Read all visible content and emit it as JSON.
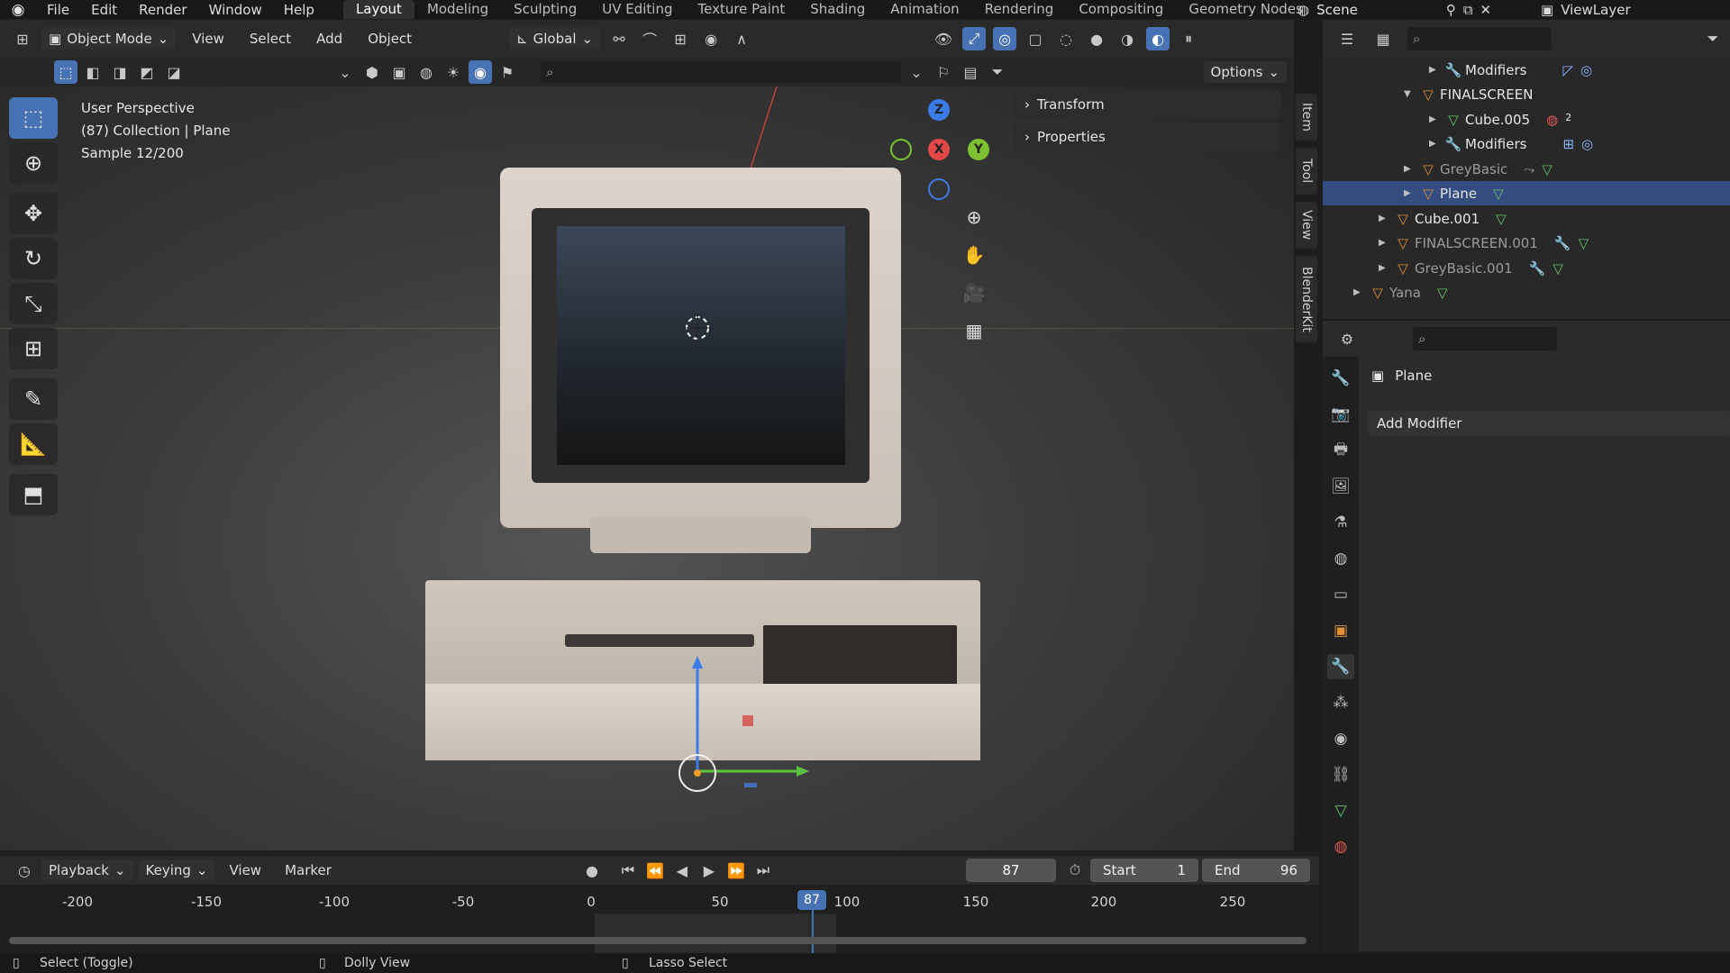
{
  "menu": {
    "items": [
      "File",
      "Edit",
      "Render",
      "Window",
      "Help"
    ]
  },
  "workspaces": [
    "Layout",
    "Modeling",
    "Sculpting",
    "UV Editing",
    "Texture Paint",
    "Shading",
    "Animation",
    "Rendering",
    "Compositing",
    "Geometry Nodes"
  ],
  "active_workspace": "Layout",
  "scene_name": "Scene",
  "view_layer": "ViewLayer",
  "viewport_header": {
    "mode": "Object Mode",
    "menus": [
      "View",
      "Select",
      "Add",
      "Object"
    ],
    "transform_orientation": "Global",
    "options_label": "Options"
  },
  "viewport_overlay": {
    "line1": "User Perspective",
    "line2": "(87) Collection | Plane",
    "line3": "Sample 12/200"
  },
  "gizmo": {
    "z": "Z",
    "x": "X",
    "y": "Y"
  },
  "npanel": {
    "transform": "Transform",
    "properties": "Properties",
    "tabs": [
      "Item",
      "Tool",
      "View",
      "BlenderKit"
    ]
  },
  "timeline": {
    "menus": [
      "Playback",
      "Keying",
      "View",
      "Marker"
    ],
    "current_frame": "87",
    "start_label": "Start",
    "start_value": "1",
    "end_label": "End",
    "end_value": "96",
    "ruler_ticks": [
      "-200",
      "-150",
      "-100",
      "-50",
      "0",
      "50",
      "100",
      "150",
      "200",
      "250"
    ],
    "playhead": "87"
  },
  "status": {
    "select": "Select (Toggle)",
    "dolly": "Dolly View",
    "lasso": "Lasso Select"
  },
  "outliner": [
    {
      "label": "Modifiers",
      "icon": "wrench-icon"
    },
    {
      "label": "FINALSCREEN",
      "icon": "mesh-object-icon"
    },
    {
      "label": "Cube.005",
      "icon": "mesh-data-icon",
      "badge": "2"
    },
    {
      "label": "Modifiers",
      "icon": "wrench-icon"
    },
    {
      "label": "GreyBasic",
      "icon": "mesh-object-icon"
    },
    {
      "label": "Plane",
      "icon": "mesh-object-icon"
    },
    {
      "label": "Cube.001",
      "icon": "mesh-object-icon"
    },
    {
      "label": "FINALSCREEN.001",
      "icon": "mesh-object-icon"
    },
    {
      "label": "GreyBasic.001",
      "icon": "mesh-object-icon"
    },
    {
      "label": "Yana",
      "icon": "mesh-object-icon"
    }
  ],
  "properties": {
    "object_name": "Plane",
    "add_modifier": "Add Modifier"
  },
  "colors": {
    "accent": "#4772b3",
    "selected_row": "#334d80",
    "object_icon": "#e08e38",
    "mesh_icon": "#66c26b"
  }
}
